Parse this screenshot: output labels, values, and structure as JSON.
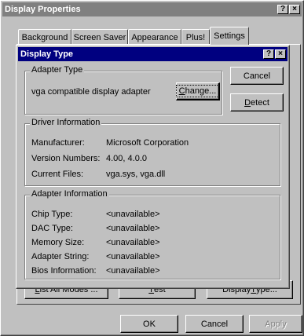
{
  "outer": {
    "title": "Display Properties",
    "help_btn": "?",
    "close_btn": "×",
    "tabs": [
      "Background",
      "Screen Saver",
      "Appearance",
      "Plus!",
      "Settings"
    ],
    "buttons": {
      "list_modes_pre": "L",
      "list_modes_post": "ist All Modes ...",
      "test_pre": "T",
      "test_post": "est",
      "display_type_pre": "Display ",
      "display_type_u": "T",
      "display_type_post": "ype...",
      "ok": "OK",
      "cancel": "Cancel",
      "apply": "Apply"
    }
  },
  "dialog": {
    "title": "Display Type",
    "help_btn": "?",
    "close_btn": "×",
    "cancel_label": "Cancel",
    "detect_pre": "",
    "detect_u": "D",
    "detect_post": "etect",
    "adapter_type": {
      "label": "Adapter Type",
      "value": "vga compatible display adapter",
      "change_u": "C",
      "change_post": "hange..."
    },
    "driver_info": {
      "label": "Driver Information",
      "rows": [
        {
          "k": "Manufacturer:",
          "v": "Microsoft Corporation"
        },
        {
          "k": "Version Numbers:",
          "v": "4.00, 4.0.0"
        },
        {
          "k": "Current Files:",
          "v": "vga.sys, vga.dll"
        }
      ]
    },
    "adapter_info": {
      "label": "Adapter Information",
      "rows": [
        {
          "k": "Chip Type:",
          "v": "<unavailable>"
        },
        {
          "k": "DAC Type:",
          "v": "<unavailable>"
        },
        {
          "k": "Memory Size:",
          "v": "<unavailable>"
        },
        {
          "k": "Adapter String:",
          "v": "<unavailable>"
        },
        {
          "k": "Bios Information:",
          "v": "<unavailable>"
        }
      ]
    }
  },
  "colors": {
    "desktop": "#008080",
    "active_title": "#000080",
    "inactive_title": "#808080",
    "face": "#c0c0c0"
  }
}
